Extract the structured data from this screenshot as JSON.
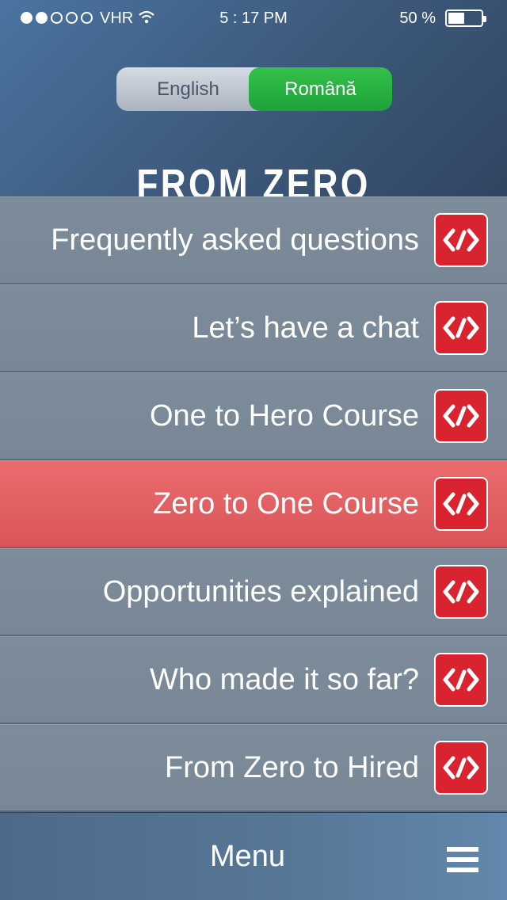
{
  "status_bar": {
    "carrier": "VHR",
    "time": "5 : 17 PM",
    "battery_text": "50 %",
    "battery_level": 0.5,
    "signal_filled": 2,
    "signal_total": 5
  },
  "language_toggle": {
    "options": [
      "English",
      "Română"
    ],
    "selected": "Română"
  },
  "hero_title": "FROM ZERO",
  "menu": {
    "items": [
      {
        "label": "Frequently asked questions",
        "icon": "code-icon"
      },
      {
        "label": "Let’s have a chat",
        "icon": "code-icon"
      },
      {
        "label": "One to Hero Course",
        "icon": "code-icon"
      },
      {
        "label": "Zero to One Course",
        "icon": "code-icon",
        "active": true
      },
      {
        "label": "Opportunities explained",
        "icon": "code-icon"
      },
      {
        "label": "Who made it so far?",
        "icon": "code-icon"
      },
      {
        "label": "From Zero to Hired",
        "icon": "code-icon"
      }
    ]
  },
  "bottom_bar": {
    "label": "Menu",
    "icon": "hamburger-icon"
  },
  "colors": {
    "accent_green": "#1fa33a",
    "active_row": "#e5605f",
    "icon_red": "#d9232e"
  }
}
